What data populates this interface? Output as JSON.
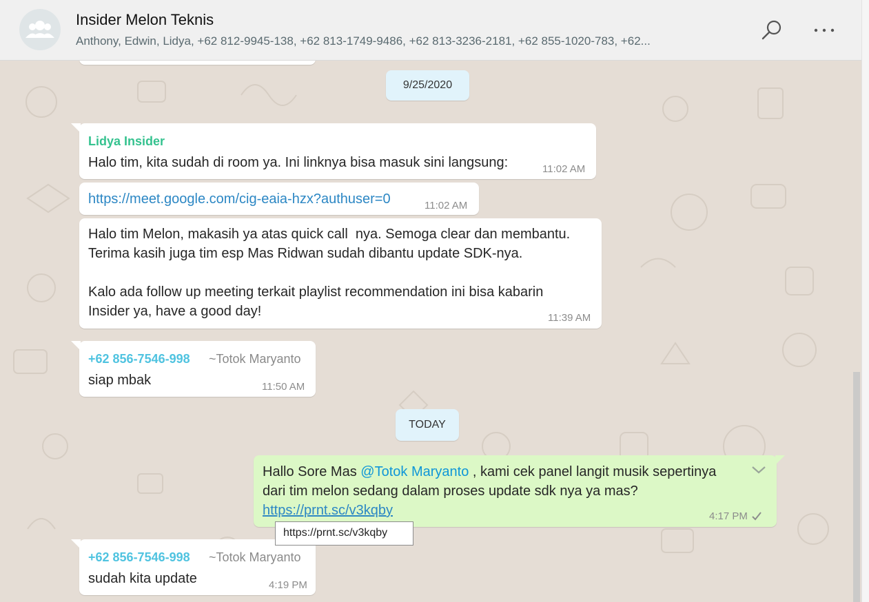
{
  "header": {
    "title": "Insider Melon Teknis",
    "members": "Anthony, Edwin, Lidya, +62 812-9945-138, +62 813-1749-9486, +62 813-3236-2181, +62 855-1020-783, +62..."
  },
  "date_chips": {
    "first": "9/25/2020",
    "today": "TODAY"
  },
  "messages": [
    {
      "sender": "Lidya Insider",
      "text": "Halo tim, kita sudah di room ya. Ini linknya bisa masuk sini langsung:",
      "time": "11:02 AM"
    },
    {
      "link": "https://meet.google.com/cig-eaia-hzx?authuser=0",
      "time": "11:02 AM"
    },
    {
      "line1": "Halo tim Melon, makasih ya atas quick call  nya. Semoga clear dan membantu.",
      "line2": "Terima kasih juga tim esp Mas Ridwan sudah dibantu update SDK-nya.",
      "line3": "Kalo ada follow up meeting terkait playlist recommendation ini bisa kabarin",
      "line4": "Insider ya, have a good day!",
      "time": "11:39 AM"
    },
    {
      "sender": "+62 856-7546-998",
      "alias": "~Totok Maryanto",
      "text": "siap mbak",
      "time": "11:50 AM"
    },
    {
      "prefix": "Hallo Sore Mas ",
      "mention": "@Totok Maryanto",
      "suffix": " , kami cek panel langit musik sepertinya",
      "line2": "dari tim melon sedang dalam proses update sdk nya ya mas?",
      "link": "https://prnt.sc/v3kqby",
      "time": "4:17 PM"
    },
    {
      "sender": "+62 856-7546-998",
      "alias": "~Totok Maryanto",
      "text": "sudah kita update",
      "time": "4:19 PM"
    }
  ],
  "tooltip": "https://prnt.sc/v3kqby",
  "icons": {
    "search": "search-icon",
    "menu": "more-options-icon",
    "avatar": "group-avatar-icon",
    "status": "single-check-icon",
    "dropdown": "chevron-down-icon"
  },
  "colors": {
    "chat_bg": "#e5ddd5",
    "outgoing_bubble": "#dcf8c6",
    "date_chip": "#e1f3fb",
    "sender_lidya": "#35c28f",
    "sender_phone": "#4fc3e0",
    "link": "#2c87c4"
  }
}
